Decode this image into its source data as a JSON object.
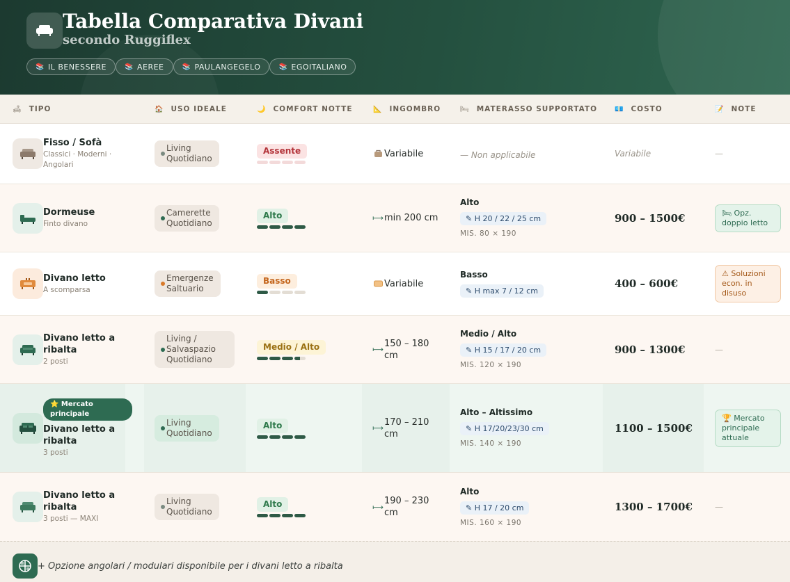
{
  "header": {
    "title": "Tabella Comparativa Divani",
    "subtitle": "secondo Ruggiflex",
    "chips": [
      {
        "icon": "book-icon",
        "label": "IL BENESSERE"
      },
      {
        "icon": "book-icon",
        "label": "AEREE"
      },
      {
        "icon": "book-icon",
        "label": "PAULANGEGELO"
      },
      {
        "icon": "book-icon",
        "label": "EGOITALIANO"
      }
    ]
  },
  "columns": [
    {
      "icon": "sofa-icon",
      "label": "TIPO"
    },
    {
      "icon": "home-icon",
      "label": "USO IDEALE"
    },
    {
      "icon": "moon-icon",
      "label": "COMFORT NOTTE"
    },
    {
      "icon": "ruler-icon",
      "label": "INGOMBRO"
    },
    {
      "icon": "bed-icon",
      "label": "MATERASSO SUPPORTATO"
    },
    {
      "icon": "money-icon",
      "label": "COSTO"
    },
    {
      "icon": "note-icon",
      "label": "NOTE"
    }
  ],
  "rows": [
    {
      "name": "Fisso / Sofà",
      "sub": "Classici · Moderni · Angolari",
      "use": "Living Quotidiano",
      "comfort": "Assente",
      "comfort_level": 0,
      "ingombro": "Variabile",
      "mat_na": "— Non applicabile",
      "cost": "Variabile",
      "note": "—"
    },
    {
      "name": "Dormeuse",
      "sub": "Finto divano",
      "use": "Camerette Quotidiano",
      "comfort": "Alto",
      "comfort_level": 4,
      "ingombro": "min 200 cm",
      "mat_level": "Alto",
      "mat_h": "H 20 / 22 / 25 cm",
      "mat_mis": "MIS. 80 × 190",
      "cost": "900 – 1500€",
      "note": "🛏 Opz. doppio letto"
    },
    {
      "name": "Divano letto",
      "sub": "A scomparsa",
      "use": "Emergenze Saltuario",
      "comfort": "Basso",
      "comfort_level": 1,
      "ingombro": "Variabile",
      "mat_level": "Basso",
      "mat_h": "H max 7 / 12 cm",
      "cost": "400 – 600€",
      "note": "⚠ Soluzioni econ. in disuso"
    },
    {
      "name": "Divano letto a ribalta",
      "sub": "2 posti",
      "use": "Living / Salvaspazio Quotidiano",
      "comfort": "Medio / Alto",
      "comfort_level": 3.5,
      "ingombro": "150 – 180 cm",
      "mat_level": "Medio / Alto",
      "mat_h": "H 15 / 17 / 20 cm",
      "mat_mis": "MIS. 120 × 190",
      "cost": "900 – 1300€",
      "note": "—"
    },
    {
      "badge": "⭐ Mercato principale",
      "name": "Divano letto a ribalta",
      "sub": "3 posti",
      "use": "Living Quotidiano",
      "comfort": "Alto",
      "comfort_level": 4,
      "ingombro": "170 – 210 cm",
      "mat_level": "Alto – Altissimo",
      "mat_h": "H 17/20/23/30 cm",
      "mat_mis": "MIS. 140 × 190",
      "cost": "1100 – 1500€",
      "note": "🏆 Mercato principale attuale"
    },
    {
      "name": "Divano letto a ribalta",
      "sub": "3 posti — MAXI",
      "use": "Living Quotidiano",
      "comfort": "Alto",
      "comfort_level": 4,
      "ingombro": "190 – 230 cm",
      "mat_level": "Alto",
      "mat_h": "H 17 / 20 cm",
      "mat_mis": "MIS. 160 × 190",
      "cost": "1300 – 1700€",
      "note": "—"
    }
  ],
  "footer": {
    "text": "+ Opzione angolari / modulari disponibile per i divani letto a ribalta"
  },
  "colors": {
    "brand_dark": "#1c3a30",
    "brand": "#2e6b52",
    "accent_orange": "#d97a2a",
    "danger": "#b3343a"
  }
}
